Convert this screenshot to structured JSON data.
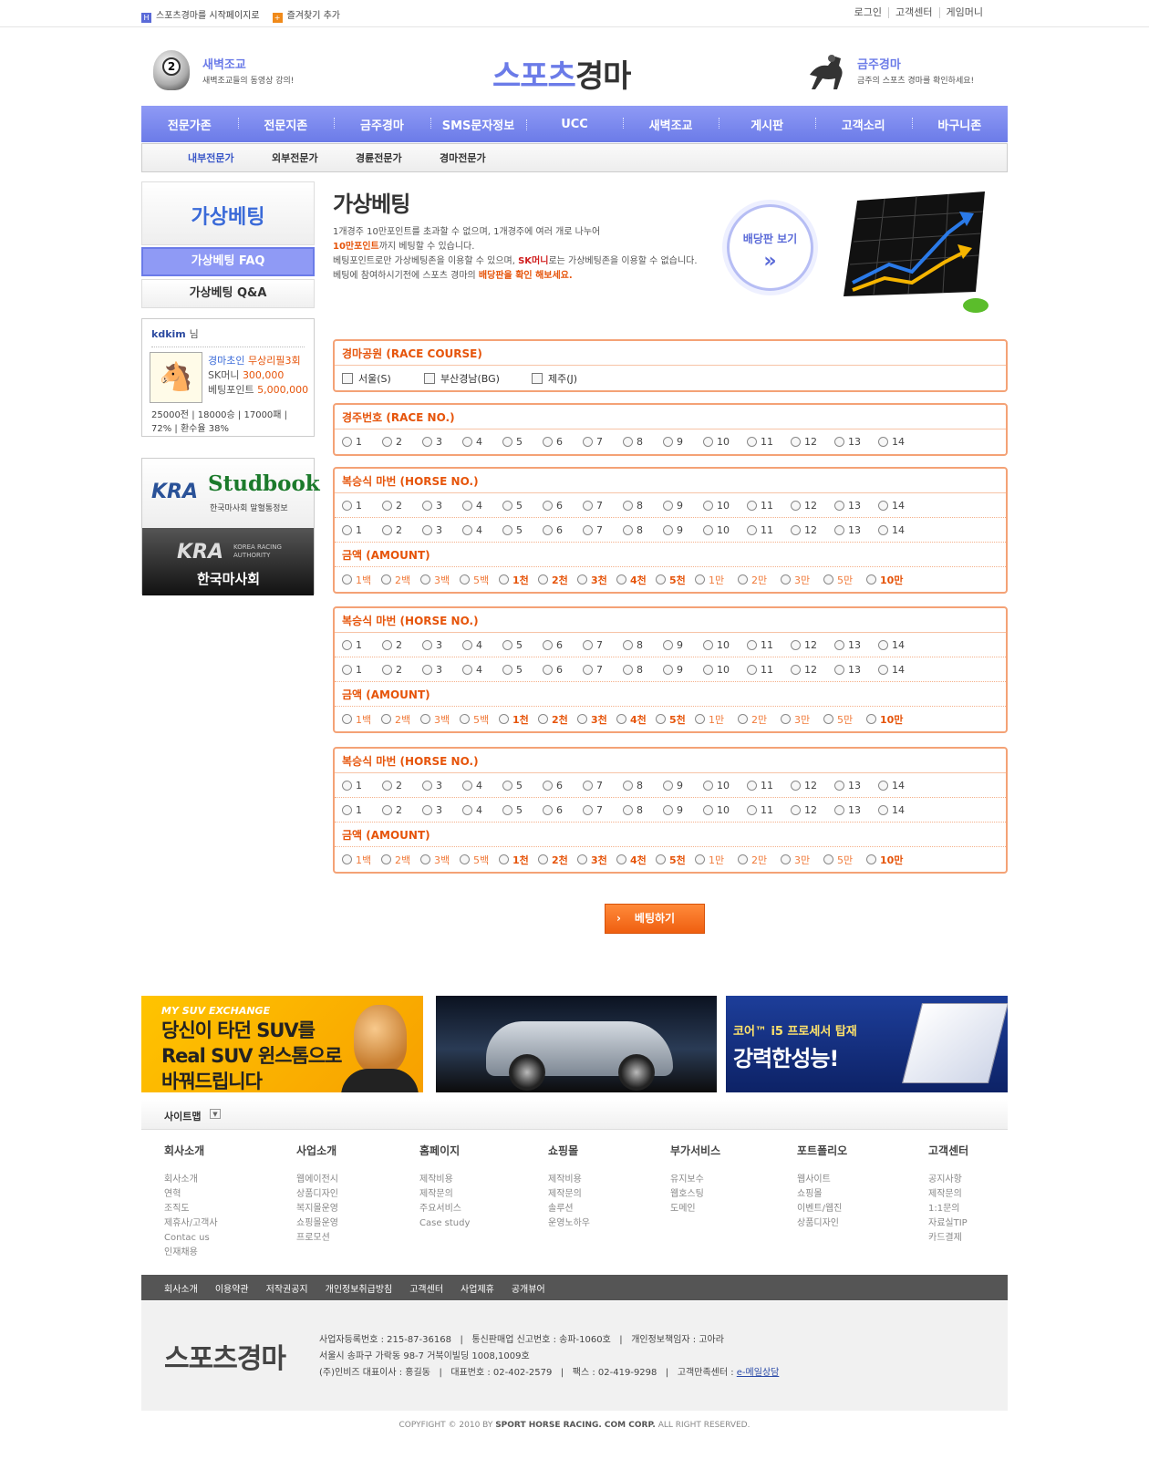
{
  "top": {
    "start_page": "스포츠경마를 시작페이지로",
    "bookmark": "즐겨찾기 추가",
    "login": "로그인",
    "support": "고객센터",
    "game_money": "게임머니"
  },
  "header": {
    "left_title": "새벽조교",
    "left_sub": "새벽조교들의 동영상 강의!",
    "logo_a": "스포츠",
    "logo_b": "경마",
    "right_title": "금주경마",
    "right_sub": "금주의 스포츠 경마를 확인하세요!"
  },
  "nav": [
    "전문가존",
    "전문지존",
    "금주경마",
    "SMS문자정보",
    "UCC",
    "새벽조교",
    "게시판",
    "고객소리",
    "바구니존"
  ],
  "subnav": [
    "내부전문가",
    "외부전문가",
    "경륜전문가",
    "경마전문가"
  ],
  "left": {
    "title": "가상베팅",
    "faq": "가상베팅 FAQ",
    "qna": "가상베팅 Q&A",
    "user": {
      "id": "kdkim",
      "suffix": "님",
      "level_label": "경마초인",
      "level_value": "무상리필3회",
      "sk_label": "SK머니",
      "sk_value": "300,000",
      "point_label": "베팅포인트",
      "point_value": "5,000,000",
      "stats": "25000전 | 18000승 | 17000패 | 72% | 환수율 38%"
    },
    "kra": {
      "studbook_k": "KRA",
      "studbook": "Studbook",
      "studbook_sub": "한국마사회 말혈통정보",
      "kra_big": "KRA",
      "kra_en1": "KOREA RACING",
      "kra_en2": "AUTHORITY",
      "kra_kor": "한국마사회"
    }
  },
  "main": {
    "title": "가상베팅",
    "line1": "1개경주 10만포인트를 초과할 수 없으며, 1개경주에 여러 개로 나누어",
    "line2_hl": "10만포인트",
    "line2": "까지 베팅할 수 있습니다.",
    "line3a": "베팅포인트로만 가상베팅존을 이용할 수 있으며, ",
    "line3_hl": "SK머니",
    "line3b": "로는 가상베팅존을 이용할 수 없습니다.",
    "line4a": "베팅에 참여하시기전에 스포츠 경마의 ",
    "line4_hl": "배당판을 확인 해보세요.",
    "board_label": "배당판 보기",
    "board_arrow": "»"
  },
  "course": {
    "label": "경마공원 (RACE COURSE)",
    "options": [
      "서울(S)",
      "부산경남(BG)",
      "제주(J)"
    ]
  },
  "race": {
    "label": "경주번호 (RACE NO.)"
  },
  "horse_label": "복승식 마번 (HORSE NO.)",
  "amount_label": "금액 (AMOUNT)",
  "numbers": [
    "1",
    "2",
    "3",
    "4",
    "5",
    "6",
    "7",
    "8",
    "9",
    "10",
    "11",
    "12",
    "13",
    "14"
  ],
  "amounts": [
    "1백",
    "2백",
    "3백",
    "5백",
    "1천",
    "2천",
    "3천",
    "4천",
    "5천",
    "1만",
    "2만",
    "3만",
    "5만",
    "10만"
  ],
  "submit": "베팅하기",
  "submit_arrow": "›",
  "banners": {
    "b1_small": "MY SUV EXCHANGE",
    "b1_l1": "당신이 타던 SUV를",
    "b1_l2": "Real SUV 윈스톰으로",
    "b1_l3": "바꿔드립니다",
    "b3_small": "코어™ i5 프로세서 탑재",
    "b3_big": "강력한성능!"
  },
  "sitemap": {
    "label": "사이트맵",
    "toggle": "▼",
    "columns": [
      {
        "title": "회사소개",
        "items": [
          "회사소개",
          "연혁",
          "조직도",
          "제휴사/고객사",
          "Contac us",
          "인재채용"
        ]
      },
      {
        "title": "사업소개",
        "items": [
          "웹에이전시",
          "상품디자인",
          "복지몰운영",
          "쇼핑몰운영",
          "프로모션"
        ]
      },
      {
        "title": "홈페이지",
        "items": [
          "제작비용",
          "제작문의",
          "주요서비스",
          "Case study"
        ]
      },
      {
        "title": "쇼핑몰",
        "items": [
          "제작비용",
          "제작문의",
          "솔루션",
          "운영노하우"
        ]
      },
      {
        "title": "부가서비스",
        "items": [
          "유지보수",
          "웹호스팅",
          "도메인"
        ]
      },
      {
        "title": "포트폴리오",
        "items": [
          "웹사이트",
          "쇼핑몰",
          "이벤트/웹진",
          "상품디자인"
        ]
      },
      {
        "title": "고객센터",
        "items": [
          "공지사항",
          "제작문의",
          "1:1문의",
          "자료실TIP",
          "카드결제"
        ]
      }
    ]
  },
  "footer_links": [
    "회사소개",
    "이용약관",
    "저작권공지",
    "개인정보취급방침",
    "고객센터",
    "사업제휴",
    "공개뷰어"
  ],
  "footer": {
    "logo": "스포츠경마",
    "line1": "사업자등록번호 : 215-87-36168   |   통신판매업 신고번호 : 송파-1060호   |   개인정보책임자 : 고아라",
    "line2": "서울시 송파구 가락동 98-7 거북이빌딩 1008,1009호",
    "line3": "(주)인비즈 대표이사 : 홍길동   |   대표번호 : 02-402-2579   |   팩스 : 02-419-9298   |   고객만족센터 : ",
    "line3_link": "e-메일상담",
    "copy_a": "COPYFIGHT © 2010 BY ",
    "copy_b": "SPORT HORSE RACING. COM CORP.",
    "copy_c": " ALL RIGHT RESERVED."
  },
  "colors": {
    "primary": "#6b7be8",
    "accent": "#e6540a",
    "panel_border": "#f4a276"
  }
}
